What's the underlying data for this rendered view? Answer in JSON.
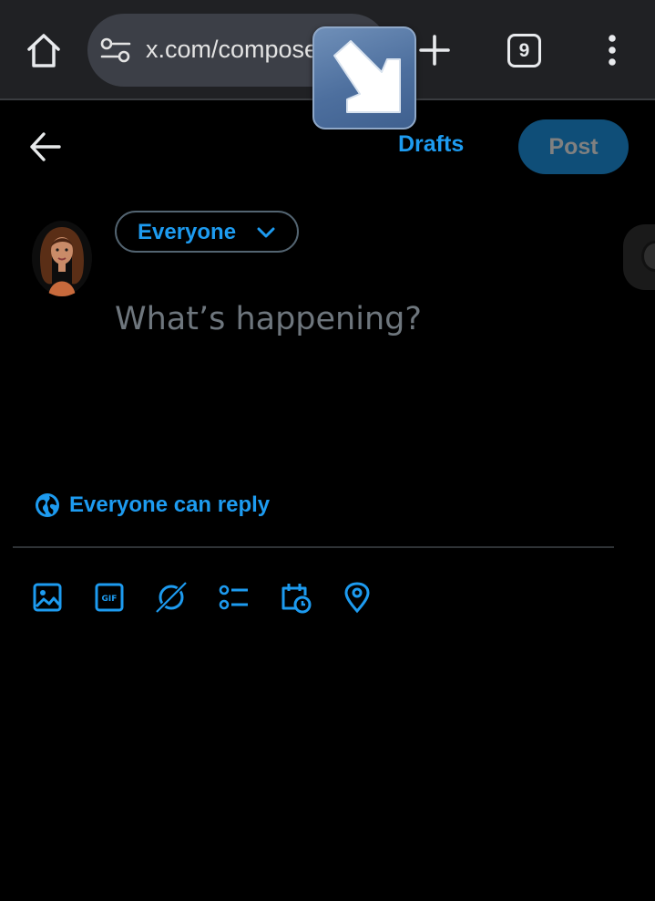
{
  "browser": {
    "url": "x.com/compose",
    "tab_count": "9",
    "icons": [
      "home-icon",
      "tune-icon",
      "arrow-badge-icon",
      "plus-icon",
      "tabs-icon",
      "more-vert-icon"
    ]
  },
  "compose": {
    "drafts_label": "Drafts",
    "post_label": "Post",
    "audience_label": "Everyone",
    "placeholder": "What’s happening?",
    "reply_setting_label": "Everyone can reply",
    "toolbar_icons": [
      "image-icon",
      "gif-icon",
      "grok-icon",
      "poll-icon",
      "schedule-icon",
      "location-icon"
    ]
  },
  "colors": {
    "accent": "#1d9bf0",
    "post_button_bg": "#0f4e78",
    "browser_bar_bg": "#202124",
    "url_pill_bg": "#3c3f47",
    "page_bg": "#000000"
  }
}
